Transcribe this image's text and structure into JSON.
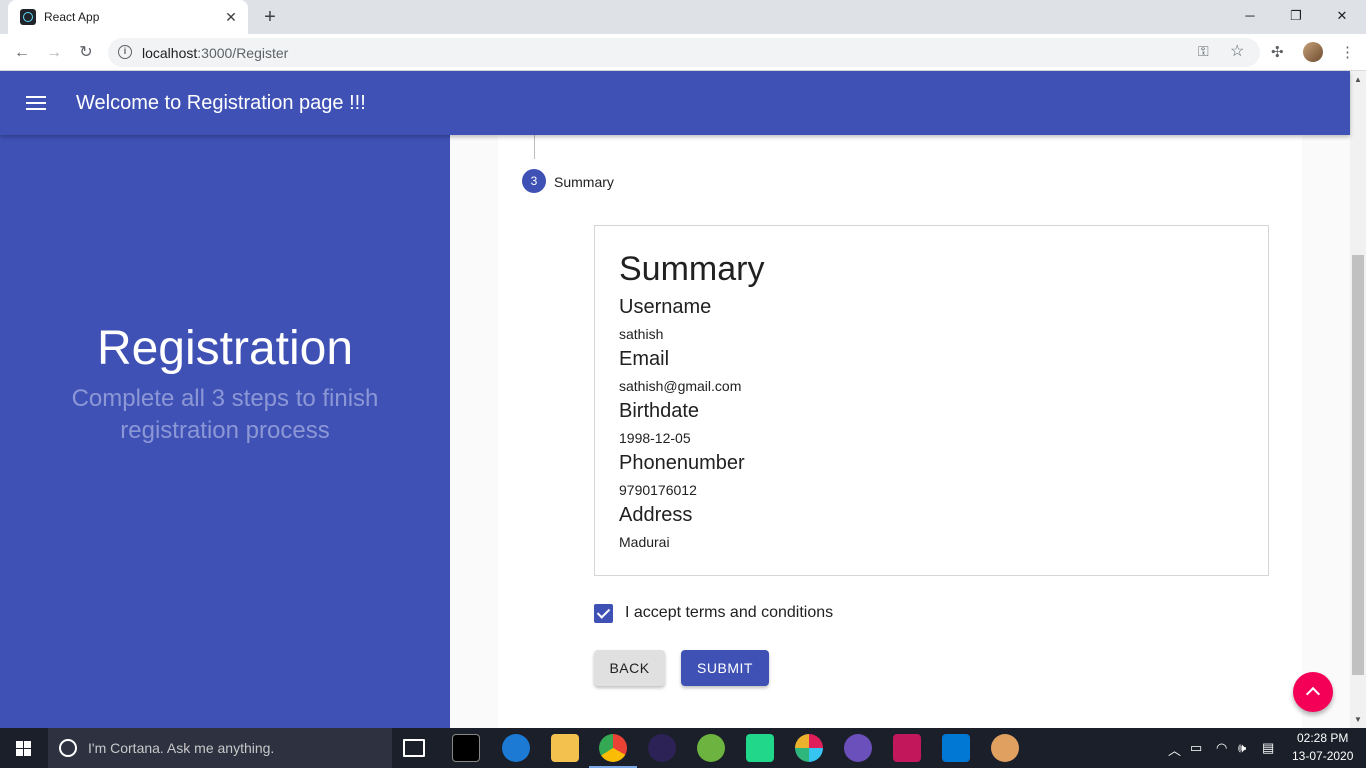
{
  "browser": {
    "tab_title": "React App",
    "tab_close": "✕",
    "new_tab": "+",
    "minimize": "─",
    "maximize": "❐",
    "close": "✕",
    "back": "←",
    "forward": "→",
    "reload": "↻",
    "url_host": "localhost",
    "url_rest": ":3000/Register"
  },
  "appbar": {
    "title": "Welcome to Registration page !!!"
  },
  "left_panel": {
    "title": "Registration",
    "subtitle": "Complete all 3 steps to finish registration process"
  },
  "stepper": {
    "step_number": "3",
    "step_label": "Summary"
  },
  "summary": {
    "heading": "Summary",
    "fields": [
      {
        "label": "Username",
        "value": "sathish"
      },
      {
        "label": "Email",
        "value": "sathish@gmail.com"
      },
      {
        "label": "Birthdate",
        "value": "1998-12-05"
      },
      {
        "label": "Phonenumber",
        "value": "9790176012"
      },
      {
        "label": "Address",
        "value": "Madurai"
      }
    ]
  },
  "terms": {
    "checked": true,
    "label": "I accept terms and conditions"
  },
  "buttons": {
    "back": "BACK",
    "submit": "SUBMIT"
  },
  "taskbar": {
    "cortana_placeholder": "I'm Cortana. Ask me anything.",
    "time": "02:28 PM",
    "date": "13-07-2020"
  },
  "colors": {
    "primary": "#3f51b5",
    "accent": "#f50057"
  }
}
